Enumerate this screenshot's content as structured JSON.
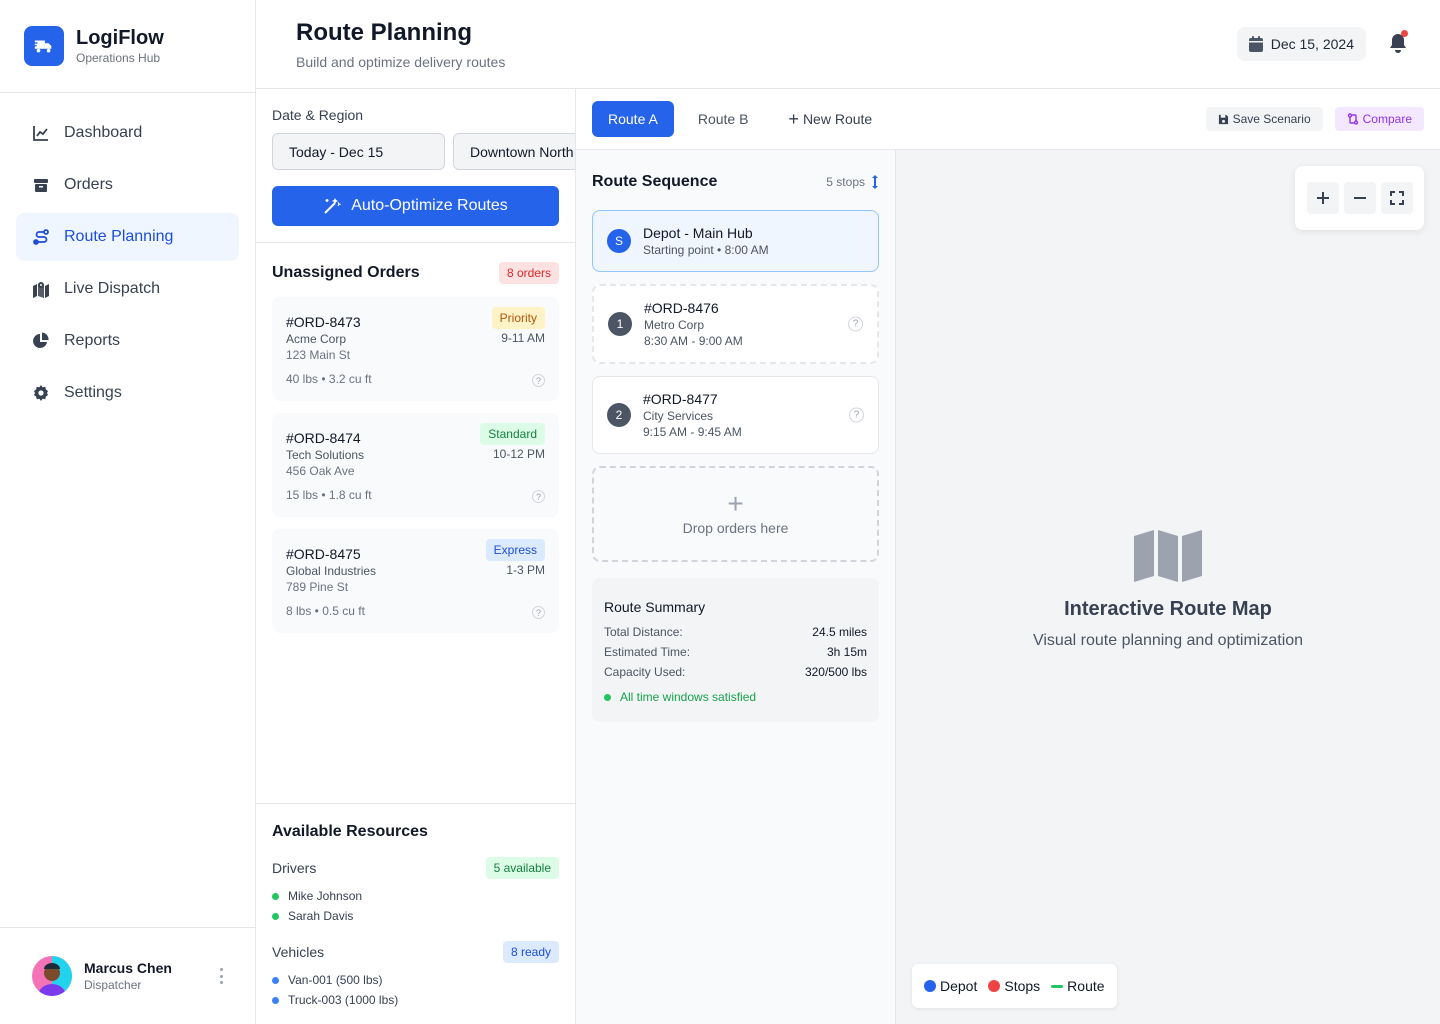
{
  "brand": {
    "name": "LogiFlow",
    "subtitle": "Operations Hub",
    "color": "#2563eb"
  },
  "nav": {
    "items": [
      {
        "label": "Dashboard",
        "icon": "chart-line-icon"
      },
      {
        "label": "Orders",
        "icon": "box-icon"
      },
      {
        "label": "Route Planning",
        "icon": "route-icon",
        "active": true
      },
      {
        "label": "Live Dispatch",
        "icon": "map-location-icon"
      },
      {
        "label": "Reports",
        "icon": "pie-chart-icon"
      },
      {
        "label": "Settings",
        "icon": "gear-icon"
      }
    ]
  },
  "user": {
    "name": "Marcus Chen",
    "role": "Dispatcher"
  },
  "header": {
    "title": "Route Planning",
    "subtitle": "Build and optimize delivery routes",
    "date": "Dec 15, 2024",
    "notification": true
  },
  "filters": {
    "label": "Date & Region",
    "date_value": "Today - Dec 15",
    "region_value": "Downtown North",
    "optimize_label": "Auto-Optimize Routes"
  },
  "unassigned": {
    "title": "Unassigned Orders",
    "count_label": "8 orders",
    "orders": [
      {
        "id": "#ORD-8473",
        "customer": "Acme Corp",
        "address": "123 Main St",
        "meta": "40 lbs • 3.2 cu ft",
        "badge": "Priority",
        "window": "9-11 AM"
      },
      {
        "id": "#ORD-8474",
        "customer": "Tech Solutions",
        "address": "456 Oak Ave",
        "meta": "15 lbs • 1.8 cu ft",
        "badge": "Standard",
        "window": "10-12 PM"
      },
      {
        "id": "#ORD-8475",
        "customer": "Global Industries",
        "address": "789 Pine St",
        "meta": "8 lbs • 0.5 cu ft",
        "badge": "Express",
        "window": "1-3 PM"
      }
    ]
  },
  "resources": {
    "title": "Available Resources",
    "drivers_label": "Drivers",
    "drivers_badge": "5 available",
    "drivers": [
      "Mike Johnson",
      "Sarah Davis"
    ],
    "vehicles_label": "Vehicles",
    "vehicles_badge": "8 ready",
    "vehicles": [
      "Van-001 (500 lbs)",
      "Truck-003 (1000 lbs)"
    ]
  },
  "tabs": {
    "items": [
      "Route A",
      "Route B"
    ],
    "new_label": "New Route",
    "save_label": "Save Scenario",
    "compare_label": "Compare"
  },
  "sequence": {
    "title": "Route Sequence",
    "stops_label": "5 stops",
    "depot": {
      "marker": "S",
      "title": "Depot - Main Hub",
      "sub": "Starting point • 8:00 AM"
    },
    "stops": [
      {
        "num": "1",
        "id": "#ORD-8476",
        "customer": "Metro Corp",
        "window": "8:30 AM - 9:00 AM"
      },
      {
        "num": "2",
        "id": "#ORD-8477",
        "customer": "City Services",
        "window": "9:15 AM - 9:45 AM"
      }
    ],
    "dropzone_label": "Drop orders here"
  },
  "summary": {
    "title": "Route Summary",
    "rows": [
      {
        "label": "Total Distance:",
        "value": "24.5 miles"
      },
      {
        "label": "Estimated Time:",
        "value": "3h 15m"
      },
      {
        "label": "Capacity Used:",
        "value": "320/500 lbs"
      }
    ],
    "status": "All time windows satisfied"
  },
  "map": {
    "title": "Interactive Route Map",
    "subtitle": "Visual route planning and optimization",
    "legend": [
      {
        "label": "Depot",
        "color": "#2563eb",
        "shape": "dot"
      },
      {
        "label": "Stops",
        "color": "#ef4444",
        "shape": "dot"
      },
      {
        "label": "Route",
        "color": "#22c55e",
        "shape": "line"
      }
    ]
  }
}
